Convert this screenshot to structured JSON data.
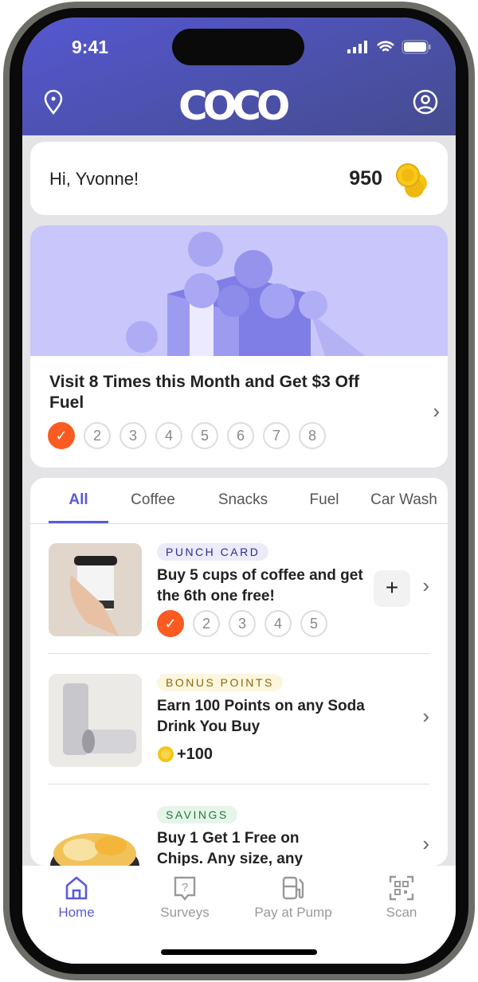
{
  "status": {
    "time": "9:41"
  },
  "header": {
    "logo": "COCO",
    "location_icon": "location-pin-icon",
    "profile_icon": "user-circle-icon"
  },
  "greeting": {
    "text": "Hi, Yvonne!",
    "points": "950"
  },
  "promo": {
    "title": "Visit 8 Times this Month and Get $3 Off Fuel",
    "steps": [
      "✓",
      "2",
      "3",
      "4",
      "5",
      "6",
      "7",
      "8"
    ],
    "completed": 1
  },
  "tabs": [
    "All",
    "Coffee",
    "Snacks",
    "Fuel",
    "Car Wash"
  ],
  "offers": [
    {
      "badge": "PUNCH CARD",
      "badge_color": "#2a2f8f",
      "badge_bg": "#ebebfa",
      "title": "Buy 5 cups of coffee and get the 6th one free!",
      "steps": [
        "✓",
        "2",
        "3",
        "4",
        "5"
      ],
      "add": "+"
    },
    {
      "badge": "BONUS POINTS",
      "badge_color": "#8a6a0a",
      "badge_bg": "#fcf6df",
      "title": "Earn 100 Points on any Soda Drink You Buy",
      "reward": "+100"
    },
    {
      "badge": "SAVINGS",
      "badge_color": "#237a3a",
      "badge_bg": "#e6f5e9",
      "title": "Buy 1 Get 1 Free on Chips. Any size, any"
    }
  ],
  "nav": [
    {
      "label": "Home",
      "icon": "home-icon"
    },
    {
      "label": "Surveys",
      "icon": "survey-icon"
    },
    {
      "label": "Pay at Pump",
      "icon": "fuel-pump-icon"
    },
    {
      "label": "Scan",
      "icon": "qr-scan-icon"
    }
  ],
  "colors": {
    "accent": "#5b5bd6",
    "check": "#fb5a20",
    "coin": "#f5c518"
  }
}
